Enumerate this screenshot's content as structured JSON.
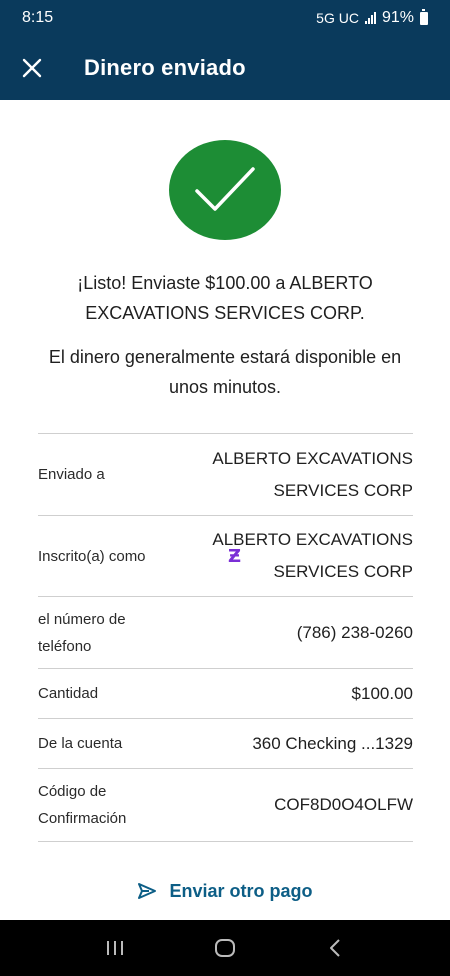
{
  "status_bar": {
    "time": "8:15",
    "network": "5G UC",
    "battery": "91%"
  },
  "header": {
    "title": "Dinero enviado",
    "close_icon": "close-icon"
  },
  "confirmation": {
    "icon": "check-icon",
    "line1": "¡Listo! Enviaste $100.00 a ALBERTO EXCAVATIONS SERVICES CORP.",
    "line2": "El dinero generalmente estará disponible en unos minutos."
  },
  "details": {
    "sent_to": {
      "label": "Enviado a",
      "value": "ALBERTO EXCAVATIONS SERVICES CORP"
    },
    "enrolled_as": {
      "label": "Inscrito(a) como",
      "value": "ALBERTO EXCAVATIONS SERVICES CORP",
      "badge": "Ƶ"
    },
    "phone": {
      "label": "el número de teléfono",
      "value": "(786) 238-0260"
    },
    "amount": {
      "label": "Cantidad",
      "value": "$100.00"
    },
    "from_account": {
      "label": "De la cuenta",
      "value": "360 Checking ...1329"
    },
    "confirmation_code": {
      "label": "Código de Confirmación",
      "value": "COF8D0O4OLFW"
    }
  },
  "actions": {
    "send_again": "Enviar otro pago"
  },
  "colors": {
    "header_bg": "#0a3a5c",
    "success_green": "#1d8d35",
    "link_blue": "#0d5e86",
    "zelle_purple": "#7b2fd6"
  }
}
